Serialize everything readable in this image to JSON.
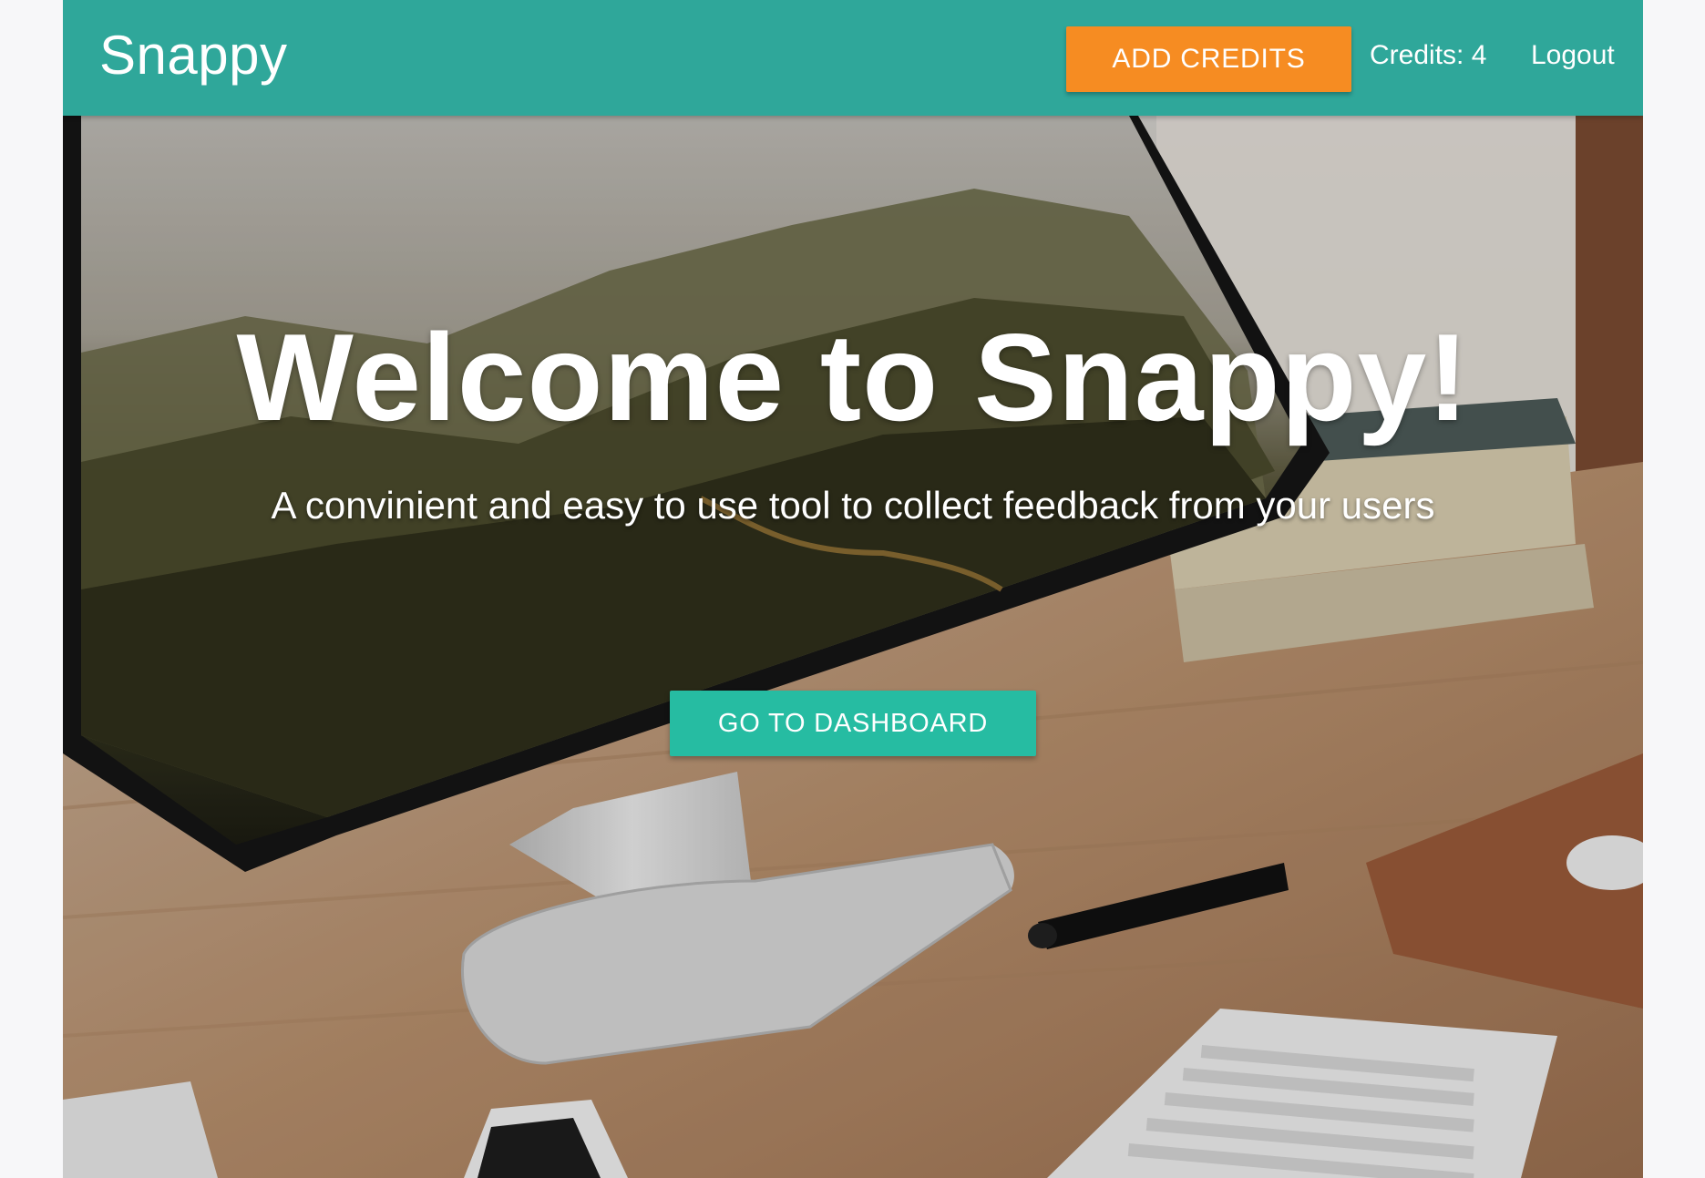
{
  "navbar": {
    "brand": "Snappy",
    "add_credits_label": "ADD CREDITS",
    "credits_label": "Credits: 4",
    "logout_label": "Logout"
  },
  "hero": {
    "title": "Welcome to Snappy!",
    "subtitle": "A convinient and easy to use tool to collect feedback from your users",
    "cta_label": "GO TO DASHBOARD"
  },
  "colors": {
    "navbar": "#2fa79a",
    "add_credits_button": "#f68c22",
    "dashboard_button": "#26bca2",
    "page_background": "#f7f7f9"
  }
}
